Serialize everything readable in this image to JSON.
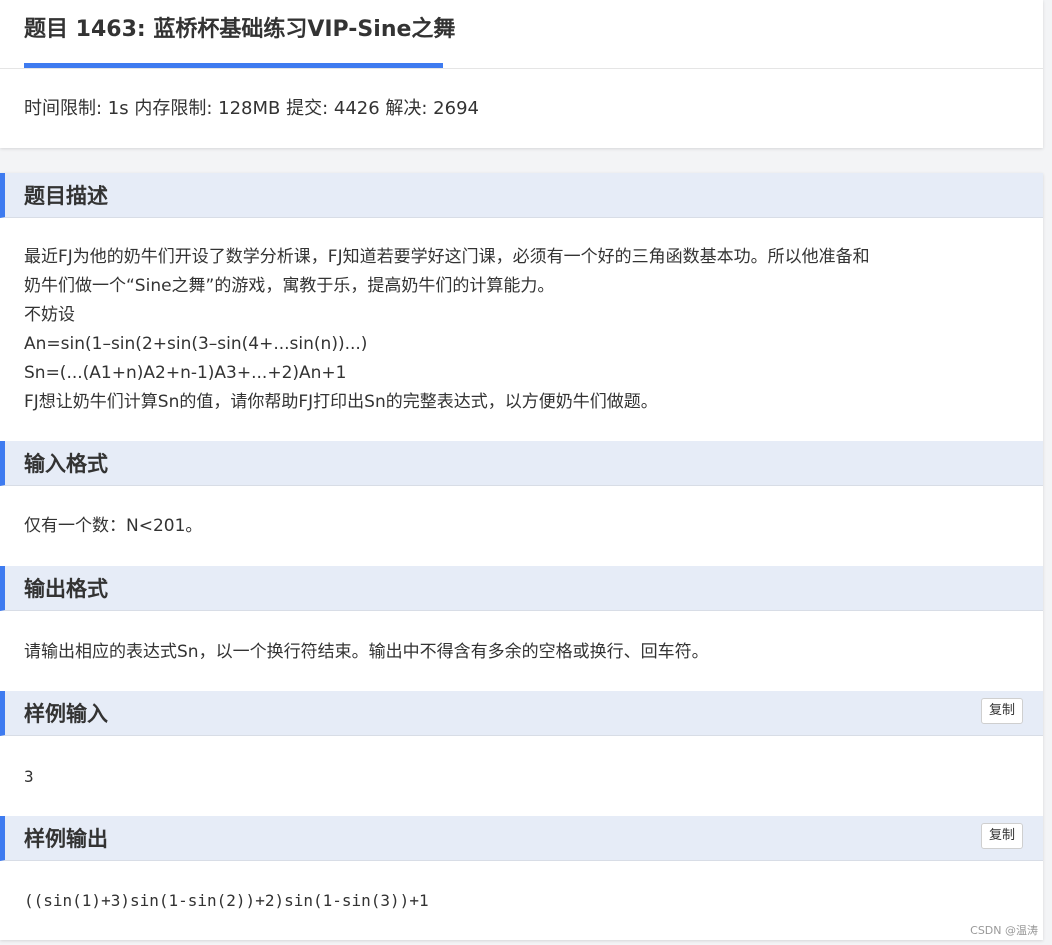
{
  "header": {
    "title": "题目 1463: 蓝桥杯基础练习VIP-Sine之舞",
    "limits": "时间限制: 1s 内存限制: 128MB 提交: 4426 解决: 2694"
  },
  "sections": {
    "description": {
      "heading": "题目描述",
      "lines": [
        "最近FJ为他的奶牛们开设了数学分析课，FJ知道若要学好这门课，必须有一个好的三角函数基本功。所以他准备和",
        "奶牛们做一个“Sine之舞”的游戏，寓教于乐，提高奶牛们的计算能力。",
        "不妨设",
        "An=sin(1–sin(2+sin(3–sin(4+...sin(n))...)",
        "Sn=(...(A1+n)A2+n-1)A3+...+2)An+1",
        "FJ想让奶牛们计算Sn的值，请你帮助FJ打印出Sn的完整表达式，以方便奶牛们做题。"
      ]
    },
    "input": {
      "heading": "输入格式",
      "text": "仅有一个数：N<201。"
    },
    "output": {
      "heading": "输出格式",
      "text": "请输出相应的表达式Sn，以一个换行符结束。输出中不得含有多余的空格或换行、回车符。"
    },
    "sample_input": {
      "heading": "样例输入",
      "copy_label": "复制",
      "text": "3"
    },
    "sample_output": {
      "heading": "样例输出",
      "copy_label": "复制",
      "text": "((sin(1)+3)sin(1-sin(2))+2)sin(1-sin(3))+1"
    }
  },
  "watermark": "CSDN @温涛"
}
